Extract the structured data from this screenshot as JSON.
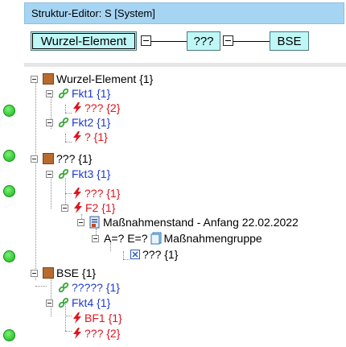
{
  "window": {
    "title": "Struktur-Editor: S [System]"
  },
  "structure_bar": {
    "boxes": [
      "Wurzel-Element",
      "???",
      "BSE"
    ]
  },
  "tree": [
    {
      "label": "Wurzel-Element {1}",
      "icon": "root-square-icon",
      "color": "black"
    },
    {
      "label": "Fkt1 {1}",
      "icon": "link-icon",
      "color": "blue"
    },
    {
      "label": "??? {2}",
      "icon": "lightning-icon",
      "color": "red"
    },
    {
      "label": "Fkt2 {1}",
      "icon": "link-icon",
      "color": "blue"
    },
    {
      "label": "? {1}",
      "icon": "lightning-icon",
      "color": "red"
    },
    {
      "label": "??? {1}",
      "icon": "root-square-icon",
      "color": "black"
    },
    {
      "label": "Fkt3 {1}",
      "icon": "link-icon",
      "color": "blue"
    },
    {
      "label": "??? {1}",
      "icon": "lightning-icon",
      "color": "red"
    },
    {
      "label": "F2 {1}",
      "icon": "lightning-icon",
      "color": "red"
    },
    {
      "label": "Maßnahmenstand - Anfang 22.02.2022",
      "icon": "document-icon",
      "color": "black"
    },
    {
      "label_prefix": "A=? E=?",
      "label": "Maßnahmengruppe",
      "icon": "book-icon",
      "color": "black"
    },
    {
      "label": "??? {1}",
      "icon": "checkbox-icon",
      "color": "black"
    },
    {
      "label": "BSE {1}",
      "icon": "root-square-icon",
      "color": "black"
    },
    {
      "label": "????? {1}",
      "icon": "link-icon",
      "color": "blue"
    },
    {
      "label": "Fkt4 {1}",
      "icon": "link-icon",
      "color": "blue"
    },
    {
      "label": "BF1 {1}",
      "icon": "lightning-icon",
      "color": "red"
    },
    {
      "label": "??? {2}",
      "icon": "lightning-icon",
      "color": "red"
    }
  ],
  "colors": {
    "title_bg": "#a6d5f3",
    "box_bg": "#bff6f6",
    "status_dot": "#22c022",
    "blue_text": "#1f3ad0",
    "red_text": "#e0141e"
  }
}
